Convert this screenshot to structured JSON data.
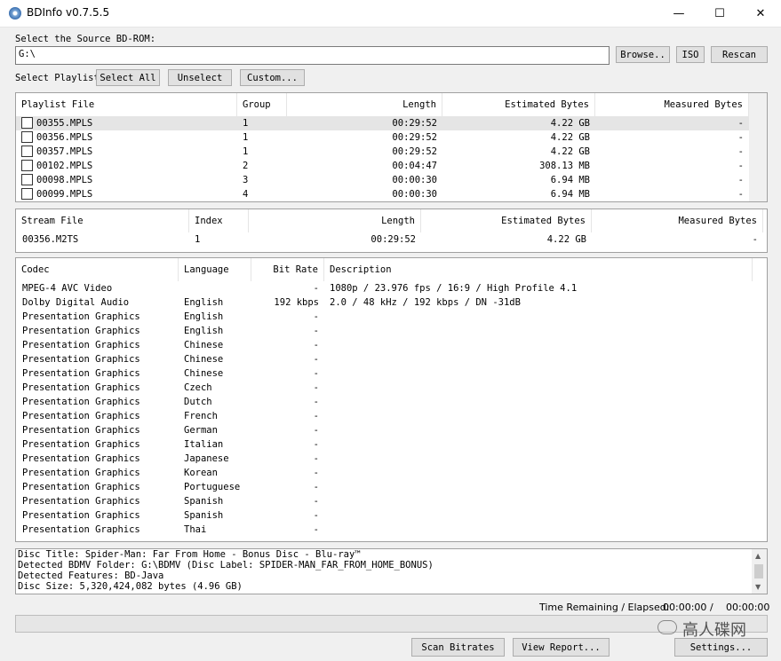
{
  "window": {
    "title": "BDInfo v0.7.5.5",
    "minimize": "—",
    "maximize": "☐",
    "close": "✕"
  },
  "source": {
    "label": "Select the Source BD-ROM:",
    "value": "G:\\",
    "browse": "Browse..",
    "iso": "ISO",
    "rescan": "Rescan"
  },
  "playlist_bar": {
    "label": "Select Playlist",
    "select_all": "Select All",
    "unselect": "Unselect",
    "custom": "Custom..."
  },
  "playlists": {
    "columns": [
      "Playlist File",
      "Group",
      "Length",
      "Estimated Bytes",
      "Measured Bytes"
    ],
    "rows": [
      {
        "file": "00355.MPLS",
        "group": "1",
        "length": "00:29:52",
        "est": "4.22 GB",
        "meas": "-"
      },
      {
        "file": "00356.MPLS",
        "group": "1",
        "length": "00:29:52",
        "est": "4.22 GB",
        "meas": "-"
      },
      {
        "file": "00357.MPLS",
        "group": "1",
        "length": "00:29:52",
        "est": "4.22 GB",
        "meas": "-"
      },
      {
        "file": "00102.MPLS",
        "group": "2",
        "length": "00:04:47",
        "est": "308.13 MB",
        "meas": "-"
      },
      {
        "file": "00098.MPLS",
        "group": "3",
        "length": "00:00:30",
        "est": "6.94 MB",
        "meas": "-"
      },
      {
        "file": "00099.MPLS",
        "group": "4",
        "length": "00:00:30",
        "est": "6.94 MB",
        "meas": "-"
      }
    ]
  },
  "streams": {
    "columns": [
      "Stream File",
      "Index",
      "Length",
      "Estimated Bytes",
      "Measured Bytes"
    ],
    "rows": [
      {
        "file": "00356.M2TS",
        "index": "1",
        "length": "00:29:52",
        "est": "4.22 GB",
        "meas": "-"
      }
    ]
  },
  "codecs": {
    "columns": [
      "Codec",
      "Language",
      "Bit Rate",
      "Description"
    ],
    "rows": [
      {
        "codec": "MPEG-4 AVC Video",
        "lang": "",
        "rate": "-",
        "desc": "1080p / 23.976 fps / 16:9 / High Profile 4.1"
      },
      {
        "codec": "Dolby Digital Audio",
        "lang": "English",
        "rate": "192 kbps",
        "desc": "2.0 / 48 kHz /   192 kbps / DN -31dB"
      },
      {
        "codec": "Presentation Graphics",
        "lang": "English",
        "rate": "-",
        "desc": ""
      },
      {
        "codec": "Presentation Graphics",
        "lang": "English",
        "rate": "-",
        "desc": ""
      },
      {
        "codec": "Presentation Graphics",
        "lang": "Chinese",
        "rate": "-",
        "desc": ""
      },
      {
        "codec": "Presentation Graphics",
        "lang": "Chinese",
        "rate": "-",
        "desc": ""
      },
      {
        "codec": "Presentation Graphics",
        "lang": "Chinese",
        "rate": "-",
        "desc": ""
      },
      {
        "codec": "Presentation Graphics",
        "lang": "Czech",
        "rate": "-",
        "desc": ""
      },
      {
        "codec": "Presentation Graphics",
        "lang": "Dutch",
        "rate": "-",
        "desc": ""
      },
      {
        "codec": "Presentation Graphics",
        "lang": "French",
        "rate": "-",
        "desc": ""
      },
      {
        "codec": "Presentation Graphics",
        "lang": "German",
        "rate": "-",
        "desc": ""
      },
      {
        "codec": "Presentation Graphics",
        "lang": "Italian",
        "rate": "-",
        "desc": ""
      },
      {
        "codec": "Presentation Graphics",
        "lang": "Japanese",
        "rate": "-",
        "desc": ""
      },
      {
        "codec": "Presentation Graphics",
        "lang": "Korean",
        "rate": "-",
        "desc": ""
      },
      {
        "codec": "Presentation Graphics",
        "lang": "Portuguese",
        "rate": "-",
        "desc": ""
      },
      {
        "codec": "Presentation Graphics",
        "lang": "Spanish",
        "rate": "-",
        "desc": ""
      },
      {
        "codec": "Presentation Graphics",
        "lang": "Spanish",
        "rate": "-",
        "desc": ""
      },
      {
        "codec": "Presentation Graphics",
        "lang": "Thai",
        "rate": "-",
        "desc": ""
      }
    ]
  },
  "disc_info": [
    "Disc Title: Spider-Man: Far From Home - Bonus Disc - Blu-ray™",
    "Detected BDMV Folder: G:\\BDMV (Disc Label: SPIDER-MAN_FAR_FROM_HOME_BONUS)",
    "Detected Features: BD-Java",
    "Disc Size: 5,320,424,082 bytes (4.96 GB)"
  ],
  "time": {
    "label": "Time Remaining / Elapsed:",
    "remaining": "00:00:00",
    "sep": "/",
    "elapsed": "00:00:00"
  },
  "progress": {
    "value": 0
  },
  "footer": {
    "scan": "Scan Bitrates",
    "report": "View Report...",
    "settings": "Settings..."
  },
  "watermark": {
    "text": "高人碟网"
  }
}
